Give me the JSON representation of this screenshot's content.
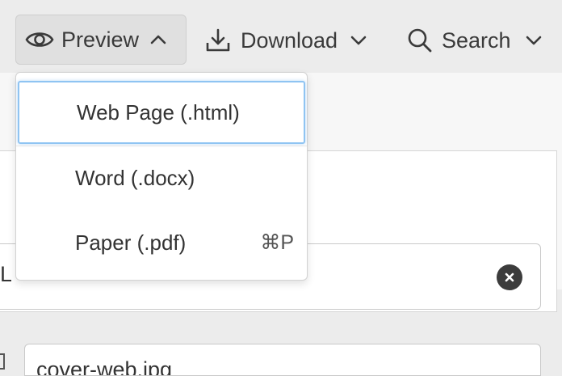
{
  "toolbar": {
    "preview": {
      "label": "Preview",
      "icon": "eye-icon",
      "chevron": "chevron-up-icon"
    },
    "download": {
      "label": "Download",
      "icon": "download-icon",
      "chevron": "chevron-down-icon"
    },
    "search": {
      "label": "Search",
      "icon": "search-icon",
      "chevron": "chevron-down-icon"
    }
  },
  "preview_menu": {
    "items": [
      {
        "label": "Web Page (.html)",
        "shortcut": ""
      },
      {
        "label": "Word (.docx)",
        "shortcut": ""
      },
      {
        "label": "Paper (.pdf)",
        "shortcut": "⌘P"
      }
    ]
  },
  "form": {
    "field1_value": "L.",
    "field2_value": "cover-web.jpg"
  },
  "colors": {
    "toolbar_bg": "#ececec",
    "selected_item_border": "#8fc4f2",
    "clear_button": "#3c3c3c"
  }
}
